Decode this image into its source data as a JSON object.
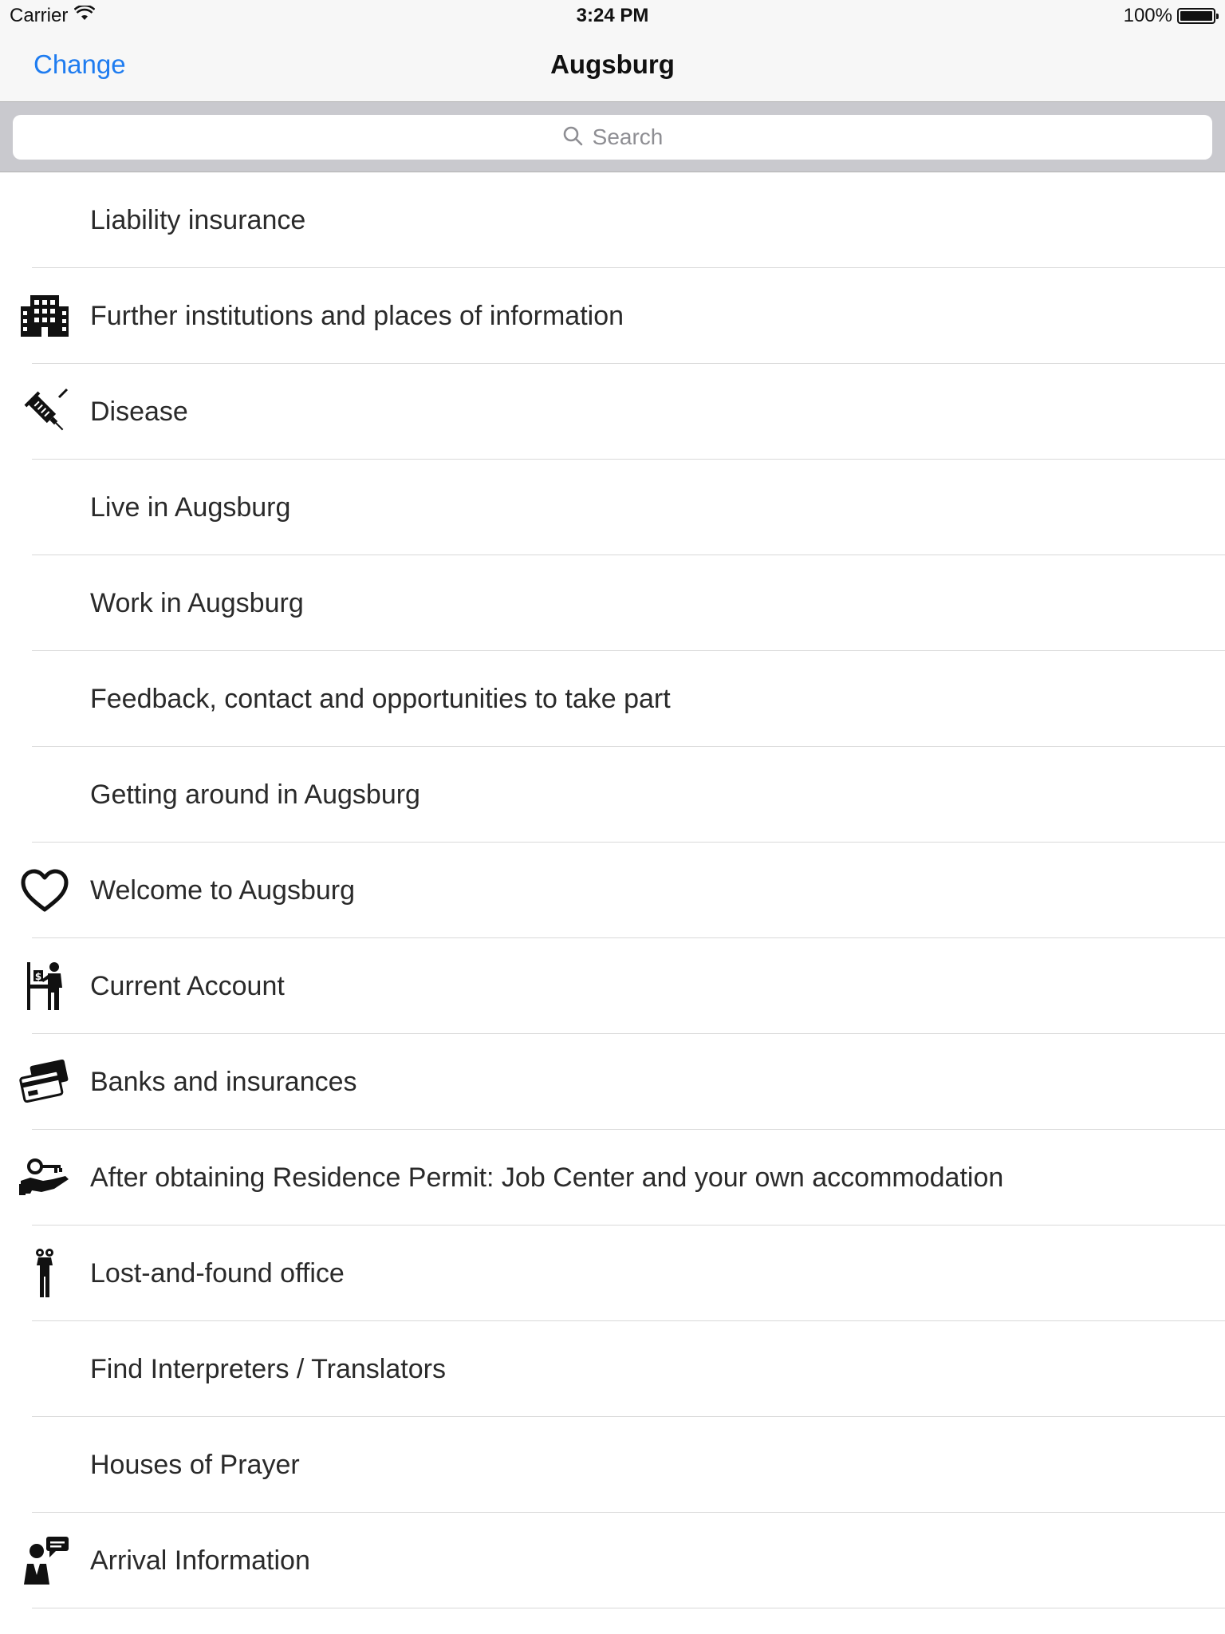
{
  "status_bar": {
    "carrier": "Carrier",
    "time": "3:24 PM",
    "battery": "100%",
    "battery_level": 1.0
  },
  "nav": {
    "left_button": "Change",
    "title": "Augsburg"
  },
  "search": {
    "placeholder": "Search"
  },
  "items": [
    {
      "label": "Liability insurance",
      "icon": ""
    },
    {
      "label": "Further institutions and places of information",
      "icon": "building-icon"
    },
    {
      "label": "Disease",
      "icon": "syringe-icon"
    },
    {
      "label": "Live in Augsburg",
      "icon": ""
    },
    {
      "label": "Work in Augsburg",
      "icon": ""
    },
    {
      "label": "Feedback, contact and opportunities to take part",
      "icon": ""
    },
    {
      "label": "Getting around in Augsburg",
      "icon": ""
    },
    {
      "label": "Welcome to Augsburg",
      "icon": "heart-icon"
    },
    {
      "label": "Current Account",
      "icon": "bank-counter-icon"
    },
    {
      "label": "Banks and insurances",
      "icon": "credit-cards-icon"
    },
    {
      "label": "After obtaining Residence Permit: Job Center and your own accommodation",
      "icon": "key-hand-icon"
    },
    {
      "label": "Lost-and-found office",
      "icon": "person-binoculars-icon"
    },
    {
      "label": "Find Interpreters / Translators",
      "icon": ""
    },
    {
      "label": "Houses of Prayer",
      "icon": ""
    },
    {
      "label": "Arrival Information",
      "icon": "person-speech-icon"
    }
  ]
}
